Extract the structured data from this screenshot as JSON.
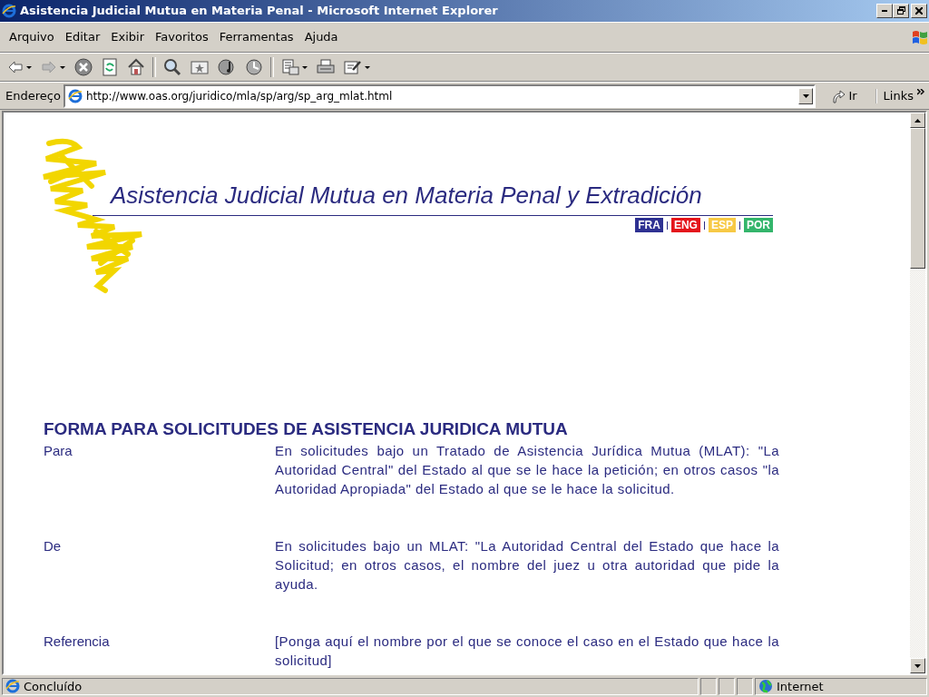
{
  "window": {
    "title": "Asistencia Judicial Mutua en Materia Penal - Microsoft Internet Explorer"
  },
  "menu": [
    "Arquivo",
    "Editar",
    "Exibir",
    "Favoritos",
    "Ferramentas",
    "Ajuda"
  ],
  "address_bar": {
    "label": "Endereço",
    "url": "http://www.oas.org/juridico/mla/sp/arg/sp_arg_mlat.html",
    "go": "Ir",
    "links": "Links"
  },
  "page": {
    "banner_title": "Asistencia Judicial Mutua en Materia Penal y Extradición",
    "languages": [
      {
        "label": "FRA",
        "color": "#2e3192"
      },
      {
        "label": "ENG",
        "color": "#e4141b"
      },
      {
        "label": "ESP",
        "color": "#f7c945"
      },
      {
        "label": "POR",
        "color": "#33b56b"
      }
    ],
    "heading": "FORMA PARA SOLICITUDES DE ASISTENCIA JURIDICA MUTUA",
    "rows": [
      {
        "label": "Para",
        "text": "En solicitudes bajo un Tratado de Asistencia Jurídica Mutua (MLAT): \"La Autoridad Central\" del Estado al que se le hace la petición; en otros casos \"la Autoridad Apropiada\" del Estado al que se le hace la solicitud."
      },
      {
        "label": "De",
        "text": "En solicitudes bajo un MLAT: \"La Autoridad Central del Estado que hace la Solicitud; en otros casos, el nombre del juez u otra autoridad que pide la ayuda."
      },
      {
        "label": "Referencia",
        "text": "[Ponga aquí el nombre por el que se conoce el caso en el Estado que hace la solicitud]"
      }
    ]
  },
  "status_bar": {
    "status": "Concluído",
    "zone": "Internet"
  }
}
